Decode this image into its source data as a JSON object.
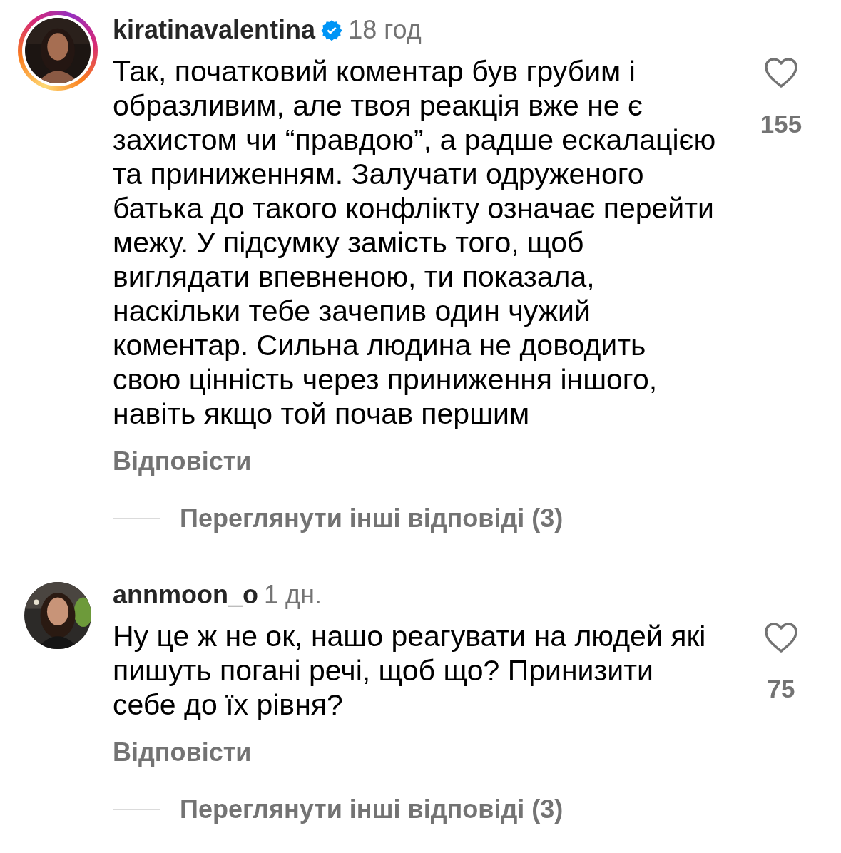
{
  "comments": [
    {
      "username": "kiratinavalentina",
      "verified": true,
      "story_ring": true,
      "time": "18 год",
      "text": "Так, початковий коментар був грубим і образливим, але твоя реакція вже не є захистом чи “правдою”, а радше ескалацією та приниженням. Залучати одруженого батька до такого конфлікту означає перейти межу. У підсумку замість того, щоб виглядати впевненою, ти показала, наскільки тебе зачепив один чужий коментар. Сильна людина не доводить свою цінність через приниження іншого, навіть якщо той почав першим",
      "liked": false,
      "likes": "155",
      "reply_label": "Відповісти",
      "view_replies": "Переглянути інші відповіді (3)"
    },
    {
      "username": "annmoon_o",
      "verified": false,
      "story_ring": false,
      "time": "1 дн.",
      "text": "Ну це ж не ок, нашо реагувати на людей які пишуть погані речі, щоб що? Принизити себе до їх рівня?",
      "liked": false,
      "likes": "75",
      "reply_label": "Відповісти",
      "view_replies": "Переглянути інші відповіді (3)"
    }
  ]
}
